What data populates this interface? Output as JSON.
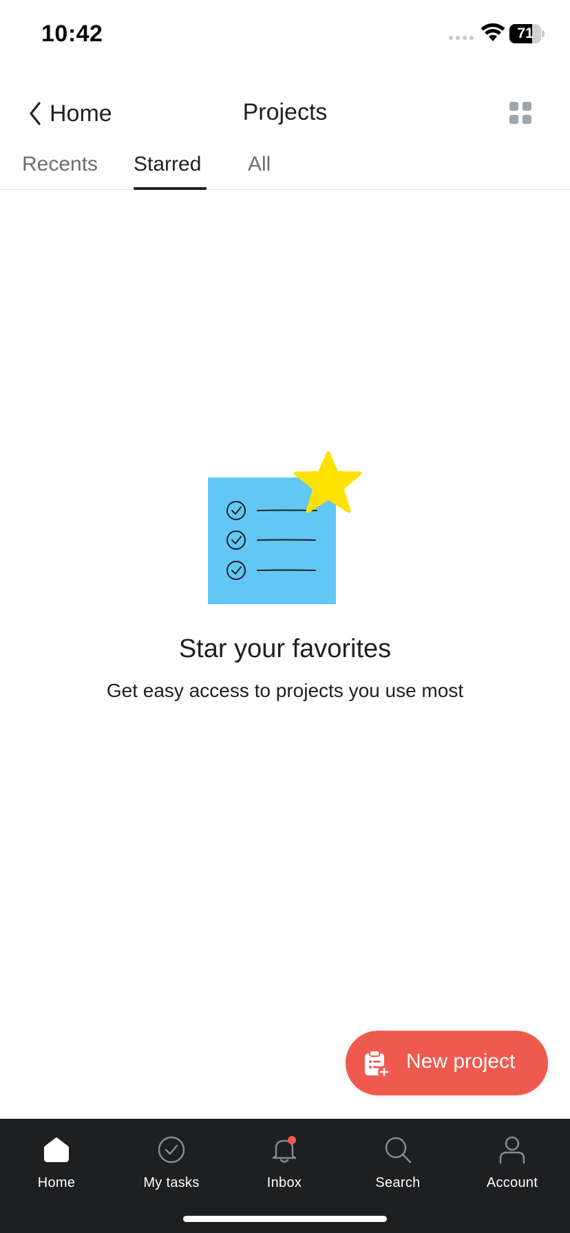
{
  "status_bar": {
    "time": "10:42",
    "battery_level": "71",
    "battery_fraction": 0.71
  },
  "nav": {
    "back_label": "Home",
    "title": "Projects",
    "back_icon": "chevron-left-icon",
    "grid_icon": "grid-icon"
  },
  "tabs": [
    {
      "label": "Recents",
      "active": false
    },
    {
      "label": "Starred",
      "active": true
    },
    {
      "label": "All",
      "active": false
    }
  ],
  "empty_state": {
    "illustration": "checklist-star-illustration",
    "title": "Star your favorites",
    "subtitle": "Get easy access to projects you use most"
  },
  "fab": {
    "label": "New project",
    "icon": "clipboard-add-icon"
  },
  "tabbar": {
    "items": [
      {
        "label": "Home",
        "icon": "home-icon",
        "active": true
      },
      {
        "label": "My tasks",
        "icon": "check-circle-icon",
        "active": false
      },
      {
        "label": "Inbox",
        "icon": "bell-icon",
        "active": false,
        "has_notification": true
      },
      {
        "label": "Search",
        "icon": "search-icon",
        "active": false
      },
      {
        "label": "Account",
        "icon": "account-icon",
        "active": false
      }
    ]
  },
  "colors": {
    "accent": "#f05a4e",
    "illustration_blue": "#62c7f5",
    "star_yellow": "#fde200",
    "tabbar_bg": "#1e1f21",
    "notification_dot": "#f05a4e"
  }
}
